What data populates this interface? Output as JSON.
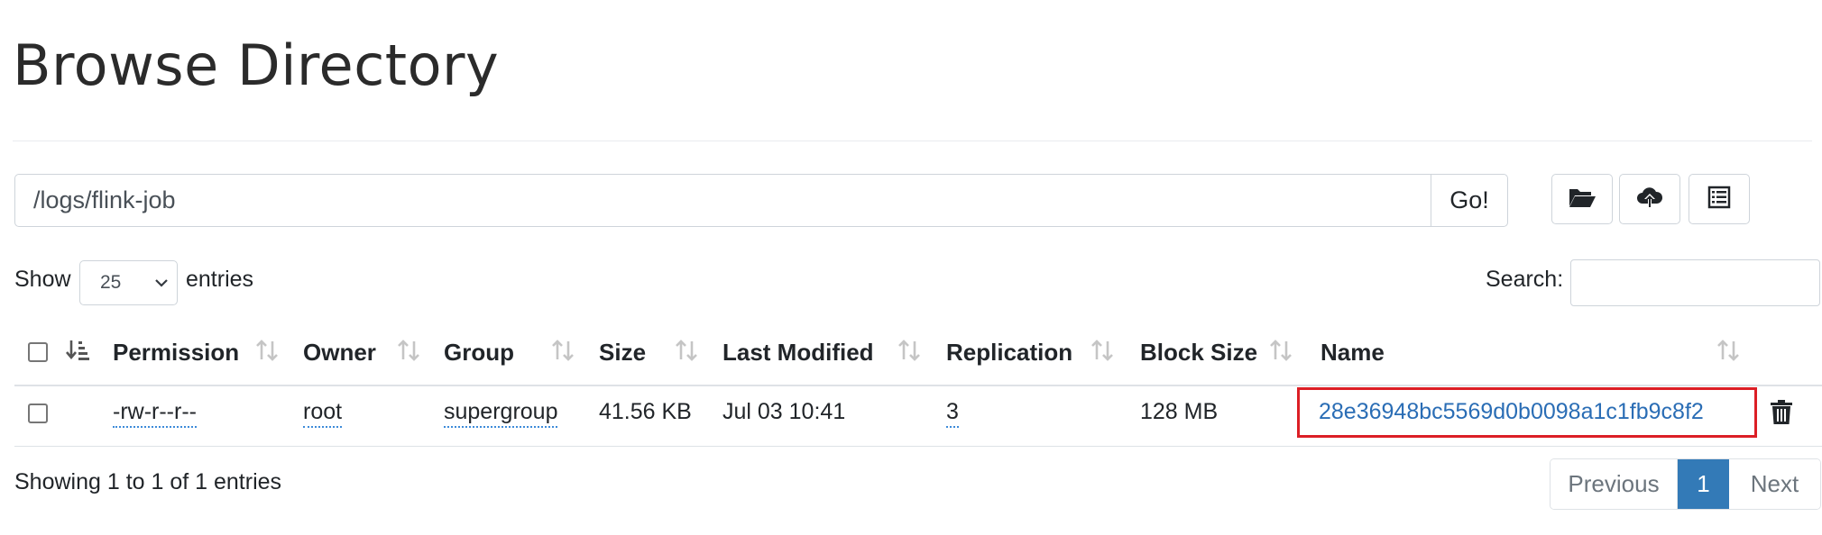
{
  "page": {
    "title": "Browse Directory"
  },
  "path_bar": {
    "value": "/logs/flink-job",
    "go_label": "Go!"
  },
  "toolbar": {
    "icons": [
      "folder-open-icon",
      "cloud-upload-icon",
      "list-icon"
    ]
  },
  "entries": {
    "show_label": "Show",
    "selected": "25",
    "entries_label": "entries"
  },
  "search": {
    "label": "Search:",
    "value": ""
  },
  "table": {
    "headers": {
      "permission": "Permission",
      "owner": "Owner",
      "group": "Group",
      "size": "Size",
      "last_modified": "Last Modified",
      "replication": "Replication",
      "block_size": "Block Size",
      "name": "Name"
    },
    "rows": [
      {
        "permission": "-rw-r--r--",
        "owner": "root",
        "group": "supergroup",
        "size": "41.56 KB",
        "last_modified": "Jul 03 10:41",
        "replication": "3",
        "block_size": "128 MB",
        "name": "28e36948bc5569d0b0098a1c1fb9c8f2"
      }
    ]
  },
  "footer": {
    "info": "Showing 1 to 1 of 1 entries"
  },
  "pagination": {
    "previous": "Previous",
    "current": "1",
    "next": "Next"
  },
  "colors": {
    "accent": "#337ab7",
    "link": "#2a6db5",
    "highlight": "#dc1f26"
  }
}
